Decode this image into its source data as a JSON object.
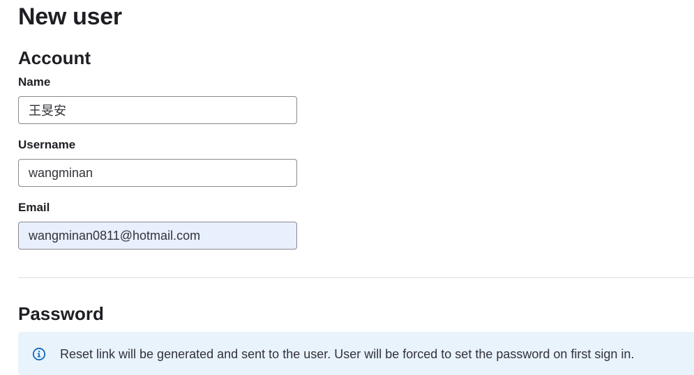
{
  "page": {
    "title": "New user"
  },
  "account": {
    "heading": "Account",
    "name": {
      "label": "Name",
      "value": "王旻安"
    },
    "username": {
      "label": "Username",
      "value": "wangminan"
    },
    "email": {
      "label": "Email",
      "value": "wangminan0811@hotmail.com"
    }
  },
  "password": {
    "heading": "Password",
    "alert": {
      "icon": "info-icon",
      "text": "Reset link will be generated and sent to the user. User will be forced to set the password on first sign in."
    }
  },
  "colors": {
    "alert_background": "#e9f3fc",
    "info_icon": "#1068bf",
    "autofill_background": "#e8f0fe"
  }
}
